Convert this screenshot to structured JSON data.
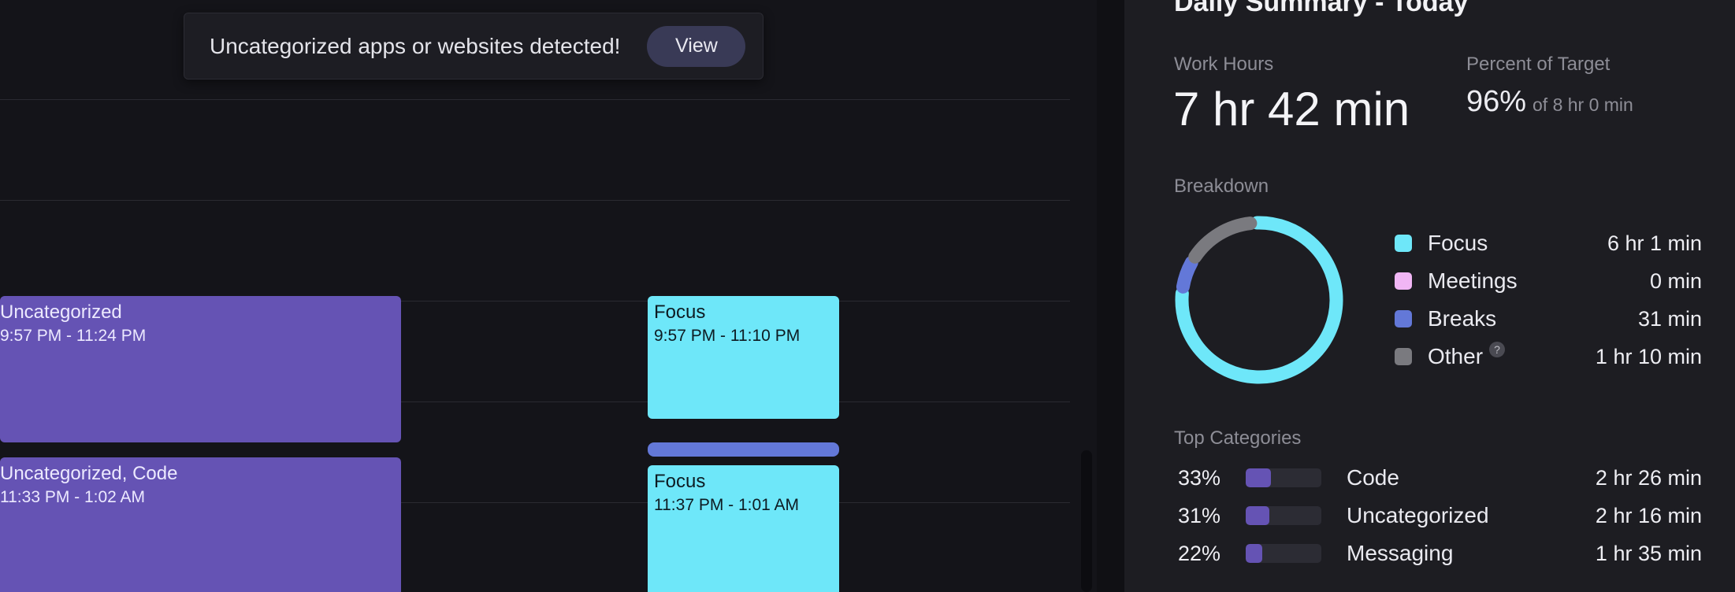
{
  "toast": {
    "message": "Uncategorized apps or websites detected!",
    "button_label": "View"
  },
  "events": [
    {
      "kind": "uncategorized",
      "title": "Uncategorized",
      "time": "9:57 PM - 11:24 PM",
      "color": "#6553b4"
    },
    {
      "kind": "uncategorized",
      "title": "Uncategorized, Code",
      "time": "11:33 PM - 1:02 AM",
      "color": "#6553b4"
    },
    {
      "kind": "focus",
      "title": "Focus",
      "time": "9:57 PM - 11:10 PM",
      "color": "#6ee7f9"
    },
    {
      "kind": "focus",
      "title": "Focus",
      "time": "11:37 PM - 1:01 AM",
      "color": "#6ee7f9"
    },
    {
      "kind": "break",
      "title": "",
      "time": "",
      "color": "#6378d8"
    }
  ],
  "summary": {
    "title": "Daily Summary - Today",
    "work_hours_label": "Work Hours",
    "work_hours_value": "7 hr 42 min",
    "target_label": "Percent of Target",
    "target_percent": "96%",
    "target_of": "of 8 hr 0 min",
    "breakdown_label": "Breakdown",
    "breakdown": [
      {
        "name": "Focus",
        "value": "6 hr 1 min",
        "minutes": 361,
        "color": "#6ee7f9"
      },
      {
        "name": "Meetings",
        "value": "0 min",
        "minutes": 0,
        "color": "#f1b6f5"
      },
      {
        "name": "Breaks",
        "value": "31 min",
        "minutes": 31,
        "color": "#6378d8"
      },
      {
        "name": "Other",
        "value": "1 hr 10 min",
        "minutes": 70,
        "color": "#7a7a7f",
        "help": "?"
      }
    ],
    "top_categories_label": "Top Categories",
    "top_categories": [
      {
        "percent": "33%",
        "fraction": 0.33,
        "name": "Code",
        "value": "2 hr 26 min"
      },
      {
        "percent": "31%",
        "fraction": 0.31,
        "name": "Uncategorized",
        "value": "2 hr 16 min"
      },
      {
        "percent": "22%",
        "fraction": 0.22,
        "name": "Messaging",
        "value": "1 hr 35 min"
      }
    ]
  }
}
